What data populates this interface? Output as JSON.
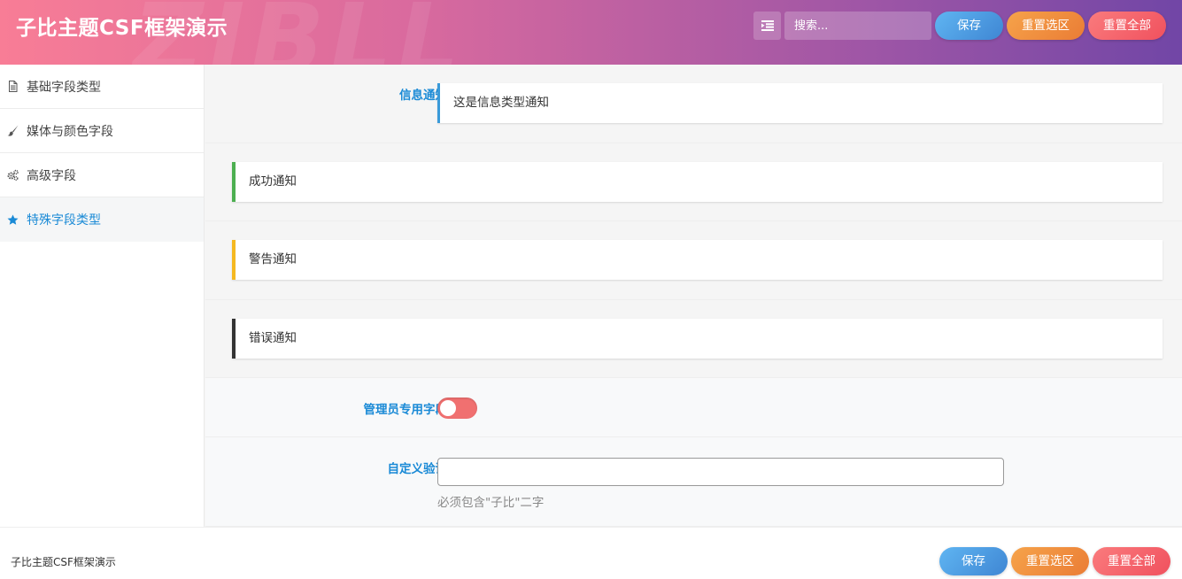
{
  "header": {
    "title": "子比主题CSF框架演示",
    "watermark": "ZIBLL",
    "search_placeholder": "搜索...",
    "save_label": "保存",
    "reset_section_label": "重置选区",
    "reset_all_label": "重置全部"
  },
  "sidebar": {
    "items": [
      {
        "label": "基础字段类型",
        "icon": "file-text-icon"
      },
      {
        "label": "媒体与颜色字段",
        "icon": "paint-brush-icon"
      },
      {
        "label": "高级字段",
        "icon": "cogs-icon"
      },
      {
        "label": "特殊字段类型",
        "icon": "star-icon",
        "active": true
      }
    ]
  },
  "content": {
    "info_label": "信息通知",
    "info_text": "这是信息类型通知",
    "success_text": "成功通知",
    "warning_text": "警告通知",
    "danger_text": "错误通知",
    "admin_label": "管理员专用字段",
    "admin_toggle_on": false,
    "validate_label": "自定义验证",
    "validate_value": "",
    "validate_help": "必须包含\"子比\"二字"
  },
  "footer": {
    "title": "子比主题CSF框架演示",
    "save_label": "保存",
    "reset_section_label": "重置选区",
    "reset_all_label": "重置全部"
  },
  "colors": {
    "accent": "#1a8ad6",
    "info": "#3a9ad9",
    "success": "#4caf50",
    "warning": "#f5b820",
    "danger": "#333333",
    "toggle_off": "#f07070"
  }
}
